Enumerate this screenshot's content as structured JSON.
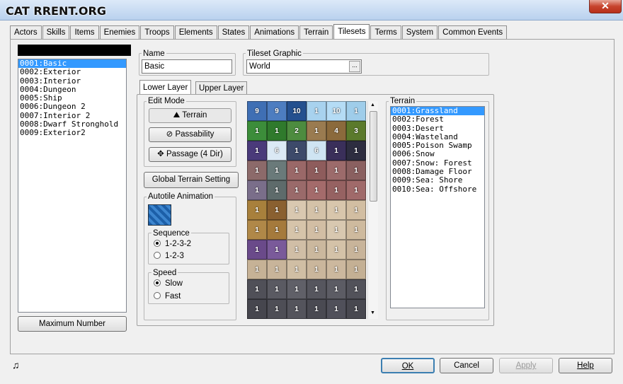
{
  "window": {
    "logo_text": "CAT RRENT.ORG",
    "close": "✕"
  },
  "tabs": [
    "Actors",
    "Skills",
    "Items",
    "Enemies",
    "Troops",
    "Elements",
    "States",
    "Animations",
    "Terrain",
    "Tilesets",
    "Terms",
    "System",
    "Common Events"
  ],
  "active_tab": "Tilesets",
  "tileset_list": [
    "0001:Basic",
    "0002:Exterior",
    "0003:Interior",
    "0004:Dungeon",
    "0005:Ship",
    "0006:Dungeon 2",
    "0007:Interior 2",
    "0008:Dwarf Stronghold",
    "0009:Exterior2"
  ],
  "max_number_label": "Maximum Number",
  "name": {
    "label": "Name",
    "value": "Basic"
  },
  "graphic": {
    "label": "Tileset Graphic",
    "value": "World",
    "ellipsis": "..."
  },
  "layers": {
    "lower": "Lower Layer",
    "upper": "Upper Layer"
  },
  "edit_mode": {
    "label": "Edit Mode",
    "terrain": "Terrain",
    "passability": "Passability",
    "passage": "Passage (4 Dir)"
  },
  "global_terrain": "Global Terrain Setting",
  "autotile": {
    "label": "Autotile Animation"
  },
  "sequence": {
    "label": "Sequence",
    "opt1": "1-2-3-2",
    "opt2": "1-2-3"
  },
  "speed": {
    "label": "Speed",
    "slow": "Slow",
    "fast": "Fast"
  },
  "terrain": {
    "label": "Terrain",
    "items": [
      "0001:Grassland",
      "0002:Forest",
      "0003:Desert",
      "0004:Wasteland",
      "0005:Poison Swamp",
      "0006:Snow",
      "0007:Snow: Forest",
      "0008:Damage Floor",
      "0009:Sea: Shore",
      "0010:Sea: Offshore"
    ]
  },
  "tiles": [
    [
      "9",
      "9",
      "10",
      "1",
      "10",
      "1"
    ],
    [
      "1",
      "1",
      "2",
      "1",
      "4",
      "3"
    ],
    [
      "1",
      "6",
      "1",
      "6",
      "1",
      "1"
    ],
    [
      "1",
      "1",
      "1",
      "1",
      "1",
      "1"
    ],
    [
      "1",
      "1",
      "1",
      "1",
      "1",
      "1"
    ],
    [
      "1",
      "1",
      "1",
      "1",
      "1",
      "1"
    ],
    [
      "1",
      "1",
      "1",
      "1",
      "1",
      "1"
    ],
    [
      "1",
      "1",
      "1",
      "1",
      "1",
      "1"
    ],
    [
      "1",
      "1",
      "1",
      "1",
      "1",
      "1"
    ],
    [
      "1",
      "1",
      "1",
      "1",
      "1",
      "1"
    ],
    [
      "1",
      "1",
      "1",
      "1",
      "1",
      "1"
    ]
  ],
  "buttons": {
    "ok": "OK",
    "cancel": "Cancel",
    "apply": "Apply",
    "help": "Help"
  },
  "music_icon": "♫"
}
